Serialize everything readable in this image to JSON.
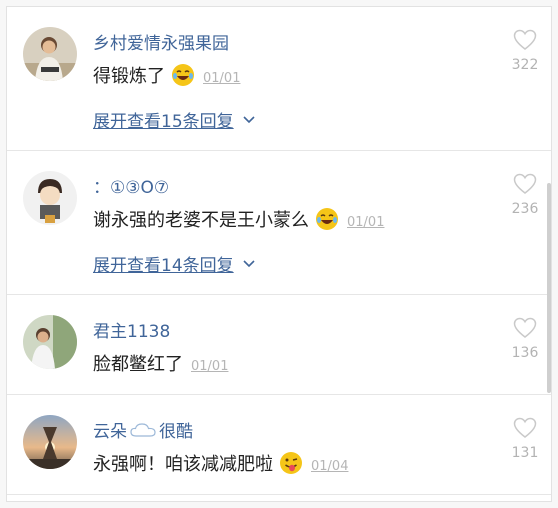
{
  "comments": [
    {
      "username": "乡村爱情永强果园",
      "text": "得锻炼了",
      "date": "01/01",
      "like_count": "322",
      "expand_label": "展开查看15条回复",
      "emoji": "laughing-tears-emoji"
    },
    {
      "username": "：①③O⑦",
      "text": "谢永强的老婆不是王小蒙么",
      "date": "01/01",
      "like_count": "236",
      "expand_label": "展开查看14条回复",
      "emoji": "laughing-tears-emoji"
    },
    {
      "username": "君主1138",
      "text": "脸都鳖红了",
      "date": "01/01",
      "like_count": "136"
    },
    {
      "username_prefix": "云朵",
      "username_suffix": "很酷",
      "text": "永强啊！咱该减减肥啦",
      "date": "01/04",
      "like_count": "131",
      "emoji": "winking-tongue-emoji"
    }
  ],
  "icons": {
    "like": "heart-outline-icon",
    "expand": "chevron-down-icon",
    "name_badge": "cloud-icon"
  },
  "colors": {
    "username": "#406599",
    "text": "#222222",
    "muted": "#b3b3b3",
    "emoji": "#f5c518"
  }
}
